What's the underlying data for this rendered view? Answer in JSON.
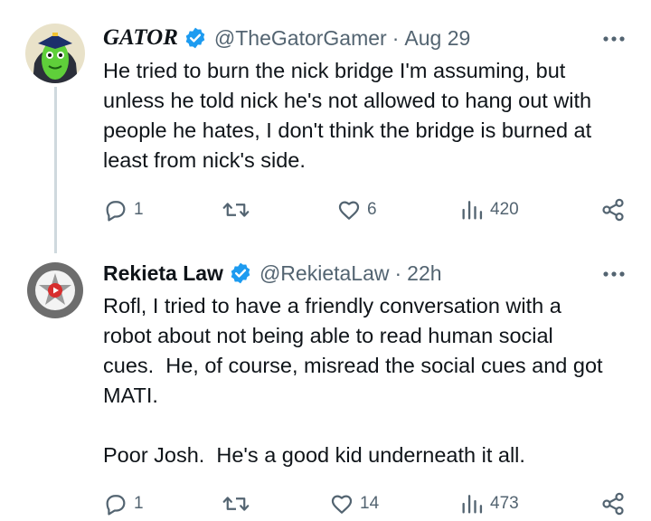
{
  "tweets": [
    {
      "author_name": "GATOR",
      "handle": "@TheGatorGamer",
      "separator": "·",
      "time": "Aug 29",
      "text": "He tried to burn the nick bridge I'm assuming, but\nunless he told nick he's not allowed to hang out with\npeople he hates, I don't think the bridge is burned at\nleast from nick's side.",
      "replies": "1",
      "retweets": "",
      "likes": "6",
      "views": "420"
    },
    {
      "author_name": "Rekieta Law",
      "handle": "@RekietaLaw",
      "separator": "·",
      "time": "22h",
      "text": "Rofl, I tried to have a friendly conversation with a\nrobot about not being able to read human social\ncues.  He, of course, misread the social cues and got\nMATI.\n\nPoor Josh.  He's a good kid underneath it all.",
      "replies": "1",
      "retweets": "",
      "likes": "14",
      "views": "473",
      "avatar_logo_text": "YOUTUBE LAWYER INTOXICATION & LITIGATION"
    }
  ],
  "colors": {
    "text_primary": "#0f1419",
    "text_secondary": "#536471",
    "verified_blue": "#1d9bf0",
    "thread_line": "#cfd9de"
  },
  "icons": [
    "verified-badge-icon",
    "more-options-icon",
    "reply-icon",
    "retweet-icon",
    "like-icon",
    "views-icon",
    "share-icon"
  ]
}
